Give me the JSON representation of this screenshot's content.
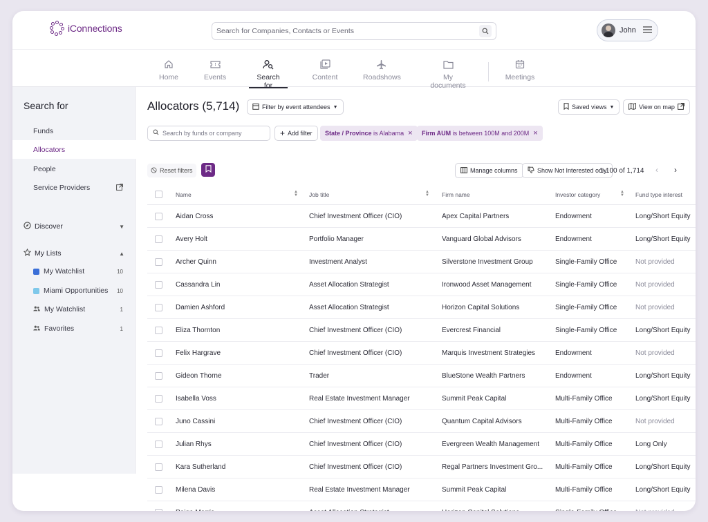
{
  "header": {
    "logo_text": "iConnections",
    "search_placeholder": "Search for Companies, Contacts or Events",
    "user_name": "John"
  },
  "nav": {
    "items": [
      {
        "label": "Home",
        "icon": "home-icon"
      },
      {
        "label": "Events",
        "icon": "ticket-icon"
      },
      {
        "label": "Search for",
        "icon": "person-search-icon",
        "active": true
      },
      {
        "label": "Content",
        "icon": "play-icon"
      },
      {
        "label": "Roadshows",
        "icon": "airplane-icon"
      },
      {
        "label": "My documents",
        "icon": "folder-icon"
      },
      {
        "label": "Meetings",
        "icon": "calendar-icon"
      }
    ]
  },
  "sidebar": {
    "title": "Search for",
    "items": [
      {
        "label": "Funds"
      },
      {
        "label": "Allocators",
        "active": true
      },
      {
        "label": "People"
      },
      {
        "label": "Service Providers"
      }
    ],
    "discover_label": "Discover",
    "lists_label": "My Lists",
    "lists": [
      {
        "label": "My Watchlist",
        "count": "10",
        "color": "#3b6fd8"
      },
      {
        "label": "Miami Opportunities",
        "count": "10",
        "color": "#7fc8ea"
      },
      {
        "label": "My Watchlist",
        "count": "1",
        "icon": "group-icon"
      },
      {
        "label": "Favorites",
        "count": "1",
        "icon": "group-icon"
      }
    ]
  },
  "main": {
    "title": "Allocators (5,714)",
    "filter_event_label": "Filter by event attendees",
    "saved_views_label": "Saved views",
    "view_map_label": "View on map",
    "search_placeholder": "Search by funds or company",
    "add_filter_label": "Add filter",
    "chips": [
      {
        "key": "State / Province",
        "rest": "is Alabama"
      },
      {
        "key": "Firm AUM",
        "rest": "is between 100M and 200M"
      }
    ],
    "reset_label": "Reset filters",
    "manage_columns_label": "Manage columns",
    "not_interested_label": "Show Not Interested only",
    "pagination": "1-100 of 1,714"
  },
  "table": {
    "columns": [
      "Name",
      "Job title",
      "Firm name",
      "Investor category",
      "Fund type interest"
    ],
    "rows": [
      [
        "Aidan Cross",
        "Chief Investment Officer (CIO)",
        "Apex Capital Partners",
        "Endowment",
        "Long/Short Equity"
      ],
      [
        "Avery Holt",
        "Portfolio Manager",
        "Vanguard Global Advisors",
        "Endowment",
        "Long/Short Equity"
      ],
      [
        "Archer Quinn",
        "Investment Analyst",
        "Silverstone Investment Group",
        "Single-Family Office",
        "Not provided"
      ],
      [
        "Cassandra Lin",
        "Asset Allocation Strategist",
        "Ironwood Asset Management",
        "Single-Family Office",
        "Not provided"
      ],
      [
        "Damien Ashford",
        "Asset Allocation Strategist",
        "Horizon Capital Solutions",
        "Single-Family Office",
        "Not provided"
      ],
      [
        "Eliza Thornton",
        "Chief Investment Officer (CIO)",
        "Evercrest Financial",
        "Single-Family Office",
        "Long/Short Equity"
      ],
      [
        "Felix Hargrave",
        "Chief Investment Officer (CIO)",
        "Marquis Investment Strategies",
        "Endowment",
        "Not provided"
      ],
      [
        "Gideon Thorne",
        "Trader",
        "BlueStone Wealth Partners",
        "Endowment",
        "Long/Short Equity"
      ],
      [
        "Isabella Voss",
        "Real Estate Investment Manager",
        "Summit Peak Capital",
        "Multi-Family Office",
        "Long/Short Equity"
      ],
      [
        "Juno Cassini",
        "Chief Investment Officer (CIO)",
        "Quantum Capital Advisors",
        "Multi-Family Office",
        "Not provided"
      ],
      [
        "Julian Rhys",
        "Chief Investment Officer (CIO)",
        "Evergreen Wealth Management",
        "Multi-Family Office",
        "Long Only"
      ],
      [
        "Kara Sutherland",
        "Chief Investment Officer (CIO)",
        "Regal Partners Investment Gro...",
        "Multi-Family Office",
        "Long/Short Equity"
      ],
      [
        "Milena Davis",
        "Real Estate Investment Manager",
        "Summit Peak Capital",
        "Multi-Family Office",
        "Long/Short Equity"
      ],
      [
        "Paige Morris",
        "Asset Allocation Strategist",
        "Horizon Capital Solutions",
        "Single-Family Office",
        "Not provided"
      ]
    ]
  }
}
